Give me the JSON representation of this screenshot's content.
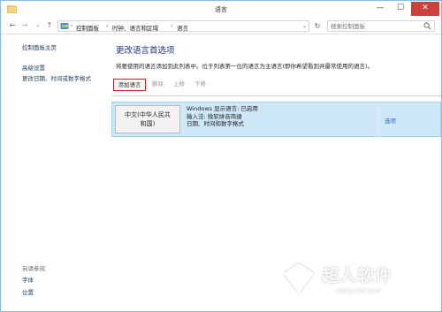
{
  "window": {
    "title": "语言",
    "min_glyph": "—",
    "max_glyph": "☐",
    "close_glyph": "✕"
  },
  "address_bar": {
    "back_glyph": "←",
    "forward_glyph": "→",
    "recent_glyph": "⌄",
    "up_glyph": "↑",
    "separator": "›",
    "breadcrumbs": [
      "控制面板",
      "时钟、语言和区域",
      "语言"
    ],
    "dropdown_glyph": "⌄",
    "refresh_glyph": "↻",
    "search_placeholder": "搜索控制面板"
  },
  "sidebar": {
    "items": [
      "控制面板主页",
      "高级设置",
      "更改日期、时间或数字格式"
    ],
    "see_also_heading": "另请参阅",
    "see_also_items": [
      "字体",
      "位置"
    ]
  },
  "main": {
    "title": "更改语言首选项",
    "description": "将要使用的语言添加到此列表中。位于列表第一位的语言为主语言(即你希望看到并最常使用的语言)。",
    "toolbar": {
      "add": "添加语言",
      "remove": "删除",
      "move_up": "上移",
      "move_down": "下移"
    },
    "languages": [
      {
        "name_line1": "中文(中华人民共",
        "name_line2": "和国)",
        "details": [
          "Windows 显示语言: 已启用",
          "输入法: 微软拼音简捷",
          "日期、时间和数字格式"
        ],
        "options_label": "选项"
      }
    ]
  },
  "watermark": {
    "text": "超人软件",
    "url": "www.crxz.com"
  },
  "colors": {
    "close_button": "#c9433c",
    "link": "#1e395b",
    "title": "#1e3287",
    "selected_row": "#cfe8f7",
    "highlight_border": "#cc1f1f"
  }
}
